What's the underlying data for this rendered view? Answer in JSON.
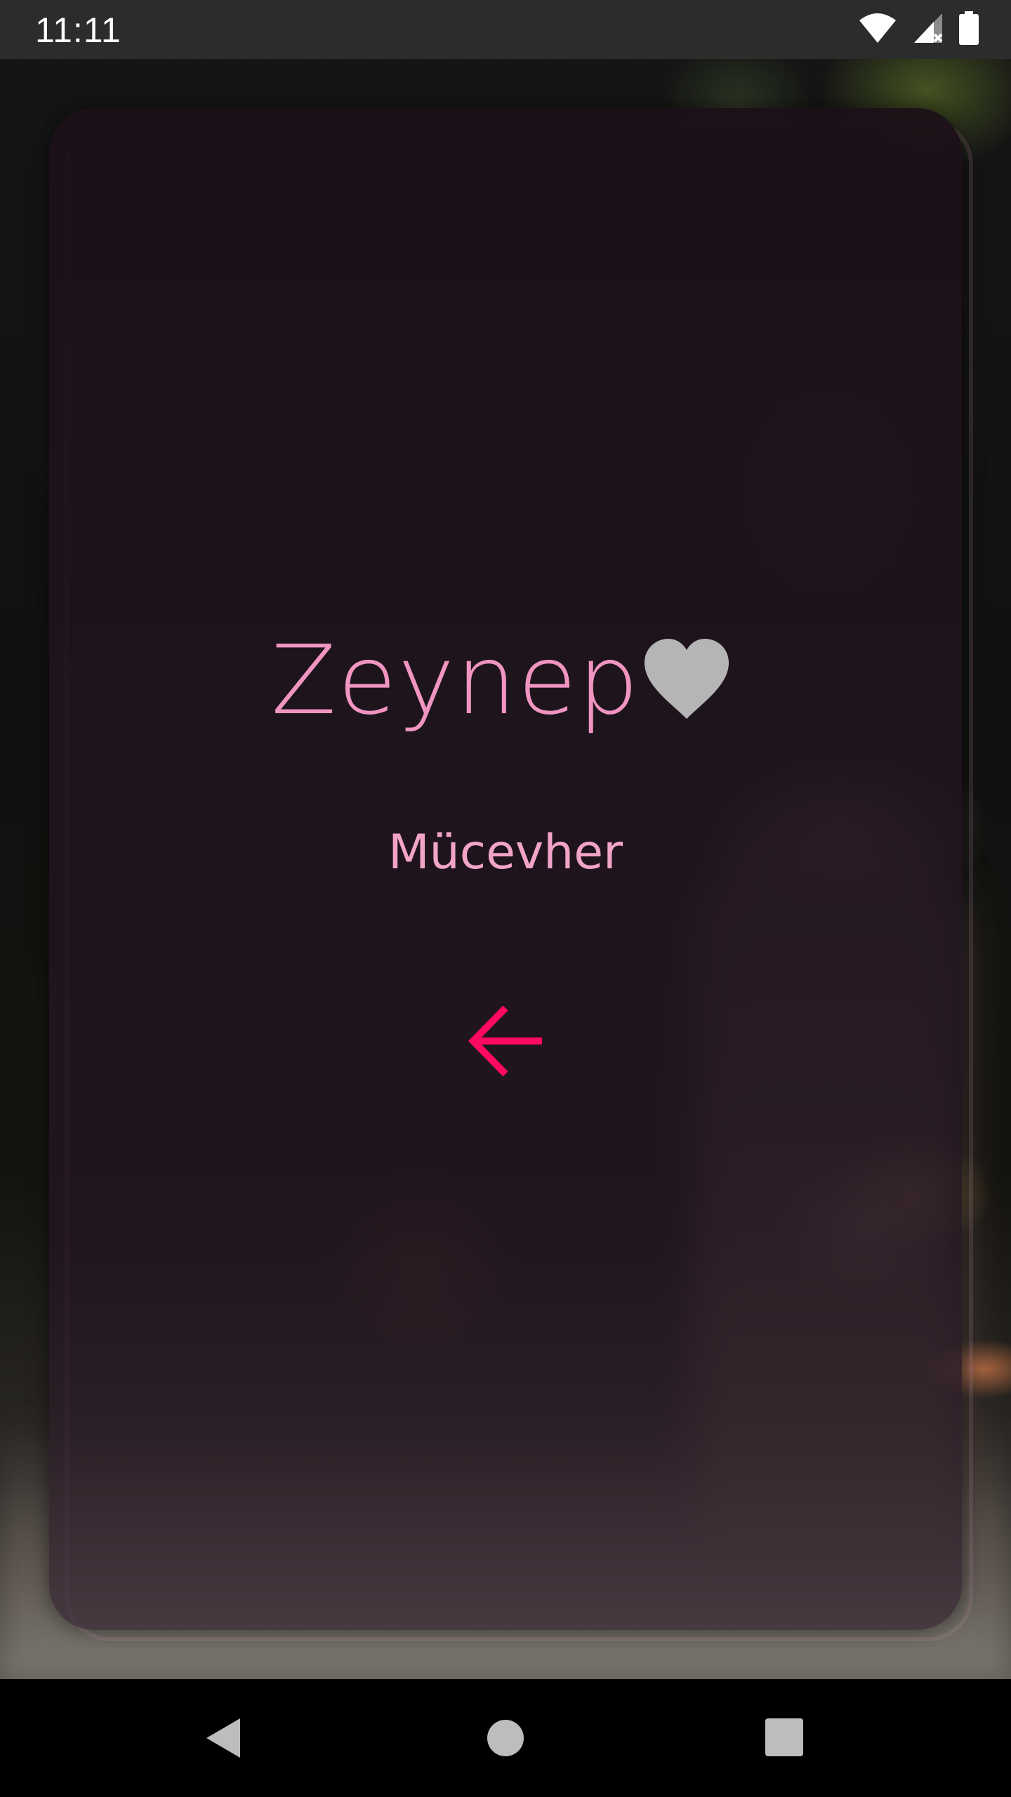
{
  "status_bar": {
    "time": "11:11",
    "icons": [
      "wifi-icon",
      "cellular-no-data-icon",
      "battery-icon"
    ]
  },
  "card": {
    "name": "Zeynep",
    "subtitle": "Mücevher",
    "favorite_icon": "heart-icon",
    "back_icon": "arrow-left-icon"
  },
  "nav_bar": {
    "buttons": [
      "back-icon",
      "home-icon",
      "recents-icon"
    ]
  },
  "colors": {
    "name": "#f095c1",
    "subtitle": "#f2a4c8",
    "arrow": "#ff0a5f",
    "heart": "#b5b5b5"
  }
}
